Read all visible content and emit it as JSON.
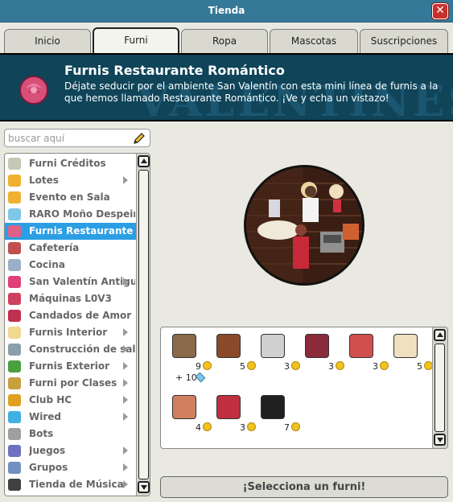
{
  "window": {
    "title": "Tienda"
  },
  "tabs": [
    {
      "label": "Inicio"
    },
    {
      "label": "Furni"
    },
    {
      "label": "Ropa"
    },
    {
      "label": "Mascotas"
    },
    {
      "label": "Suscripciones"
    }
  ],
  "banner": {
    "heading": "Furnis Restaurante Romántico",
    "description": "Déjate seducir por el ambiente San Valentín con esta mini línea de furnis a la que hemos llamado Restaurante Romántico. ¡Ve y echa un vistazo!",
    "watermark": "VALENTINES"
  },
  "search": {
    "placeholder": "buscar aquí"
  },
  "categories": [
    {
      "label": "Furni Créditos",
      "icon": "credits-icon",
      "color": "#c8c8b8",
      "arrow": false
    },
    {
      "label": "Lotes",
      "icon": "lotes-icon",
      "color": "#f0b030",
      "arrow": true
    },
    {
      "label": "Evento en Sala",
      "icon": "event-icon",
      "color": "#f0b030",
      "arrow": false
    },
    {
      "label": "RARO Moño Despeinado",
      "icon": "rare-icon",
      "color": "#7fc8e8",
      "arrow": false
    },
    {
      "label": "Furnis Restaurante Romántico",
      "icon": "rose-icon",
      "color": "#e0608a",
      "arrow": false,
      "selected": true
    },
    {
      "label": "Cafetería",
      "icon": "cafe-icon",
      "color": "#c05050",
      "arrow": false
    },
    {
      "label": "Cocina",
      "icon": "kitchen-icon",
      "color": "#9ab0c8",
      "arrow": false
    },
    {
      "label": "San Valentín Antiguo",
      "icon": "heart-icon",
      "color": "#e0407a",
      "arrow": true
    },
    {
      "label": "Máquinas L0V3",
      "icon": "mask-icon",
      "color": "#d04060",
      "arrow": false
    },
    {
      "label": "Candados de Amor",
      "icon": "lock-icon",
      "color": "#c03050",
      "arrow": false
    },
    {
      "label": "Furnis Interior",
      "icon": "table-icon",
      "color": "#f0d890",
      "arrow": true
    },
    {
      "label": "Construcción de salas",
      "icon": "build-icon",
      "color": "#8aa0a8",
      "arrow": true
    },
    {
      "label": "Furnis Exterior",
      "icon": "plant-icon",
      "color": "#4aa040",
      "arrow": true
    },
    {
      "label": "Furni por Clases",
      "icon": "star-icon",
      "color": "#c8a040",
      "arrow": true
    },
    {
      "label": "Club HC",
      "icon": "hc-icon",
      "color": "#e0a020",
      "arrow": true
    },
    {
      "label": "Wired",
      "icon": "wired-icon",
      "color": "#40b0e0",
      "arrow": true
    },
    {
      "label": "Bots",
      "icon": "bot-icon",
      "color": "#a0a0a0",
      "arrow": false
    },
    {
      "label": "Juegos",
      "icon": "games-icon",
      "color": "#7070c0",
      "arrow": true
    },
    {
      "label": "Grupos",
      "icon": "groups-icon",
      "color": "#7090c0",
      "arrow": true
    },
    {
      "label": "Tienda de Música",
      "icon": "music-icon",
      "color": "#404040",
      "arrow": true
    }
  ],
  "products": [
    {
      "price": "9",
      "icon": "register-icon",
      "color": "#8a6a4a",
      "extra": "+ 10"
    },
    {
      "price": "5",
      "icon": "cabinet-icon",
      "color": "#8a4a2a"
    },
    {
      "price": "3",
      "icon": "ice-bucket-icon",
      "color": "#d0d0d0"
    },
    {
      "price": "3",
      "icon": "chair-icon",
      "color": "#8a2a3a"
    },
    {
      "price": "3",
      "icon": "heart-cake-icon",
      "color": "#d05050"
    },
    {
      "price": "5",
      "icon": "round-table-icon",
      "color": "#f0e0c0"
    },
    {
      "price": "4",
      "icon": "petals-icon",
      "color": "#d08060"
    },
    {
      "price": "3",
      "icon": "bouquet-icon",
      "color": "#c03040"
    },
    {
      "price": "7",
      "icon": "stool-icon",
      "color": "#202020"
    }
  ],
  "footer": {
    "select_label": "¡Selecciona un furni!"
  }
}
